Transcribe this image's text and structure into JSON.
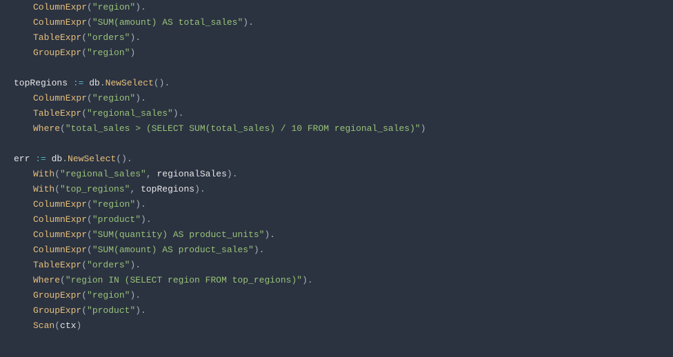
{
  "tokens": [
    [
      [
        "indent",
        1
      ],
      [
        "method",
        "ColumnExpr"
      ],
      [
        "punc",
        "("
      ],
      [
        "string",
        "\"region\""
      ],
      [
        "punc",
        ")."
      ]
    ],
    [
      [
        "indent",
        1
      ],
      [
        "method",
        "ColumnExpr"
      ],
      [
        "punc",
        "("
      ],
      [
        "string",
        "\"SUM(amount) AS total_sales\""
      ],
      [
        "punc",
        ")."
      ]
    ],
    [
      [
        "indent",
        1
      ],
      [
        "method",
        "TableExpr"
      ],
      [
        "punc",
        "("
      ],
      [
        "string",
        "\"orders\""
      ],
      [
        "punc",
        ")."
      ]
    ],
    [
      [
        "indent",
        1
      ],
      [
        "method",
        "GroupExpr"
      ],
      [
        "punc",
        "("
      ],
      [
        "string",
        "\"region\""
      ],
      [
        "punc",
        ")"
      ]
    ],
    [
      [
        "blank",
        ""
      ]
    ],
    [
      [
        "ident",
        "topRegions "
      ],
      [
        "op",
        ":="
      ],
      [
        "ident",
        " db"
      ],
      [
        "punc",
        "."
      ],
      [
        "method",
        "NewSelect"
      ],
      [
        "punc",
        "()."
      ]
    ],
    [
      [
        "indent",
        1
      ],
      [
        "method",
        "ColumnExpr"
      ],
      [
        "punc",
        "("
      ],
      [
        "string",
        "\"region\""
      ],
      [
        "punc",
        ")."
      ]
    ],
    [
      [
        "indent",
        1
      ],
      [
        "method",
        "TableExpr"
      ],
      [
        "punc",
        "("
      ],
      [
        "string",
        "\"regional_sales\""
      ],
      [
        "punc",
        ")."
      ]
    ],
    [
      [
        "indent",
        1
      ],
      [
        "method",
        "Where"
      ],
      [
        "punc",
        "("
      ],
      [
        "string",
        "\"total_sales > (SELECT SUM(total_sales) / 10 FROM regional_sales)\""
      ],
      [
        "punc",
        ")"
      ]
    ],
    [
      [
        "blank",
        ""
      ]
    ],
    [
      [
        "ident",
        "err "
      ],
      [
        "op",
        ":="
      ],
      [
        "ident",
        " db"
      ],
      [
        "punc",
        "."
      ],
      [
        "method",
        "NewSelect"
      ],
      [
        "punc",
        "()."
      ]
    ],
    [
      [
        "indent",
        1
      ],
      [
        "method",
        "With"
      ],
      [
        "punc",
        "("
      ],
      [
        "string",
        "\"regional_sales\""
      ],
      [
        "punc",
        ", "
      ],
      [
        "ident",
        "regionalSales"
      ],
      [
        "punc",
        ")."
      ]
    ],
    [
      [
        "indent",
        1
      ],
      [
        "method",
        "With"
      ],
      [
        "punc",
        "("
      ],
      [
        "string",
        "\"top_regions\""
      ],
      [
        "punc",
        ", "
      ],
      [
        "ident",
        "topRegions"
      ],
      [
        "punc",
        ")."
      ]
    ],
    [
      [
        "indent",
        1
      ],
      [
        "method",
        "ColumnExpr"
      ],
      [
        "punc",
        "("
      ],
      [
        "string",
        "\"region\""
      ],
      [
        "punc",
        ")."
      ]
    ],
    [
      [
        "indent",
        1
      ],
      [
        "method",
        "ColumnExpr"
      ],
      [
        "punc",
        "("
      ],
      [
        "string",
        "\"product\""
      ],
      [
        "punc",
        ")."
      ]
    ],
    [
      [
        "indent",
        1
      ],
      [
        "method",
        "ColumnExpr"
      ],
      [
        "punc",
        "("
      ],
      [
        "string",
        "\"SUM(quantity) AS product_units\""
      ],
      [
        "punc",
        ")."
      ]
    ],
    [
      [
        "indent",
        1
      ],
      [
        "method",
        "ColumnExpr"
      ],
      [
        "punc",
        "("
      ],
      [
        "string",
        "\"SUM(amount) AS product_sales\""
      ],
      [
        "punc",
        ")."
      ]
    ],
    [
      [
        "indent",
        1
      ],
      [
        "method",
        "TableExpr"
      ],
      [
        "punc",
        "("
      ],
      [
        "string",
        "\"orders\""
      ],
      [
        "punc",
        ")."
      ]
    ],
    [
      [
        "indent",
        1
      ],
      [
        "method",
        "Where"
      ],
      [
        "punc",
        "("
      ],
      [
        "string",
        "\"region IN (SELECT region FROM top_regions)\""
      ],
      [
        "punc",
        ")."
      ]
    ],
    [
      [
        "indent",
        1
      ],
      [
        "method",
        "GroupExpr"
      ],
      [
        "punc",
        "("
      ],
      [
        "string",
        "\"region\""
      ],
      [
        "punc",
        ")."
      ]
    ],
    [
      [
        "indent",
        1
      ],
      [
        "method",
        "GroupExpr"
      ],
      [
        "punc",
        "("
      ],
      [
        "string",
        "\"product\""
      ],
      [
        "punc",
        ")."
      ]
    ],
    [
      [
        "indent",
        1
      ],
      [
        "method",
        "Scan"
      ],
      [
        "punc",
        "("
      ],
      [
        "ident",
        "ctx"
      ],
      [
        "punc",
        ")"
      ]
    ]
  ]
}
